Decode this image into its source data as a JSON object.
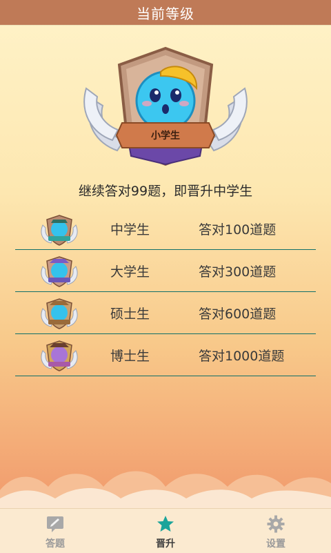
{
  "header": {
    "title": "当前等级"
  },
  "current_level": {
    "badge_label": "小学生"
  },
  "progress_text": "继续答对99题，即晋升中学生",
  "levels": [
    {
      "name": "中学生",
      "requirement": "答对100道题",
      "color": "#2fa49c"
    },
    {
      "name": "大学生",
      "requirement": "答对300道题",
      "color": "#6b57b8"
    },
    {
      "name": "硕士生",
      "requirement": "答对600道题",
      "color": "#9a6b3a"
    },
    {
      "name": "博士生",
      "requirement": "答对1000道题",
      "color": "#a85aa8"
    }
  ],
  "tabs": [
    {
      "label": "答题",
      "icon": "pencil-note-icon",
      "active": false
    },
    {
      "label": "晋升",
      "icon": "star-icon",
      "active": true
    },
    {
      "label": "设置",
      "icon": "gear-icon",
      "active": false
    }
  ],
  "colors": {
    "topbar": "#bf7a57",
    "accent_star": "#1aa49a",
    "divider": "#0f6f69"
  }
}
